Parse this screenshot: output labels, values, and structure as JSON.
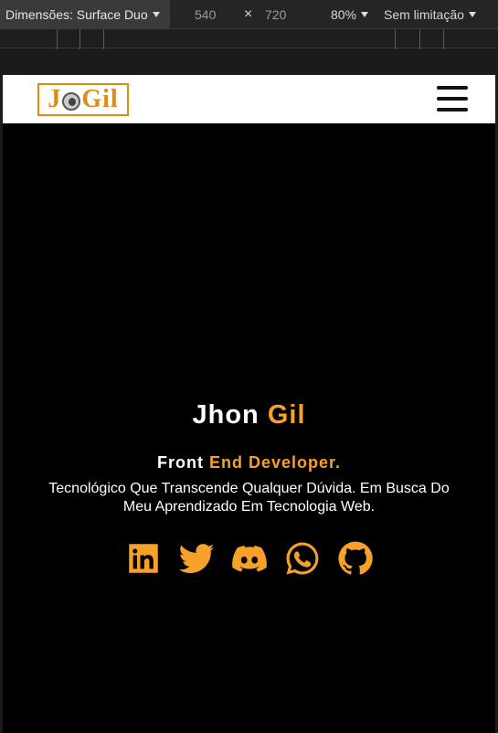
{
  "devtools": {
    "dimensions_label": "Dimensões: Surface Duo",
    "width": "540",
    "separator": "×",
    "height": "720",
    "zoom": "80%",
    "throttle": "Sem limitação"
  },
  "site": {
    "logo_text_j": "J",
    "logo_text_rest": "Gil",
    "menu_icon": "hamburger-icon"
  },
  "hero": {
    "name_first": "Jhon",
    "name_last": "Gil",
    "role_front": "Front",
    "role_end": "End",
    "role_dev": "Developer.",
    "description": "Tecnológico Que Transcende Qualquer Dúvida. Em Busca Do Meu Aprendizado Em Tecnologia Web.",
    "social": [
      "linkedin-icon",
      "twitter-icon",
      "discord-icon",
      "whatsapp-icon",
      "github-icon"
    ]
  },
  "colors": {
    "accent": "#f6a12a",
    "background": "#000000",
    "header": "#ffffff"
  }
}
